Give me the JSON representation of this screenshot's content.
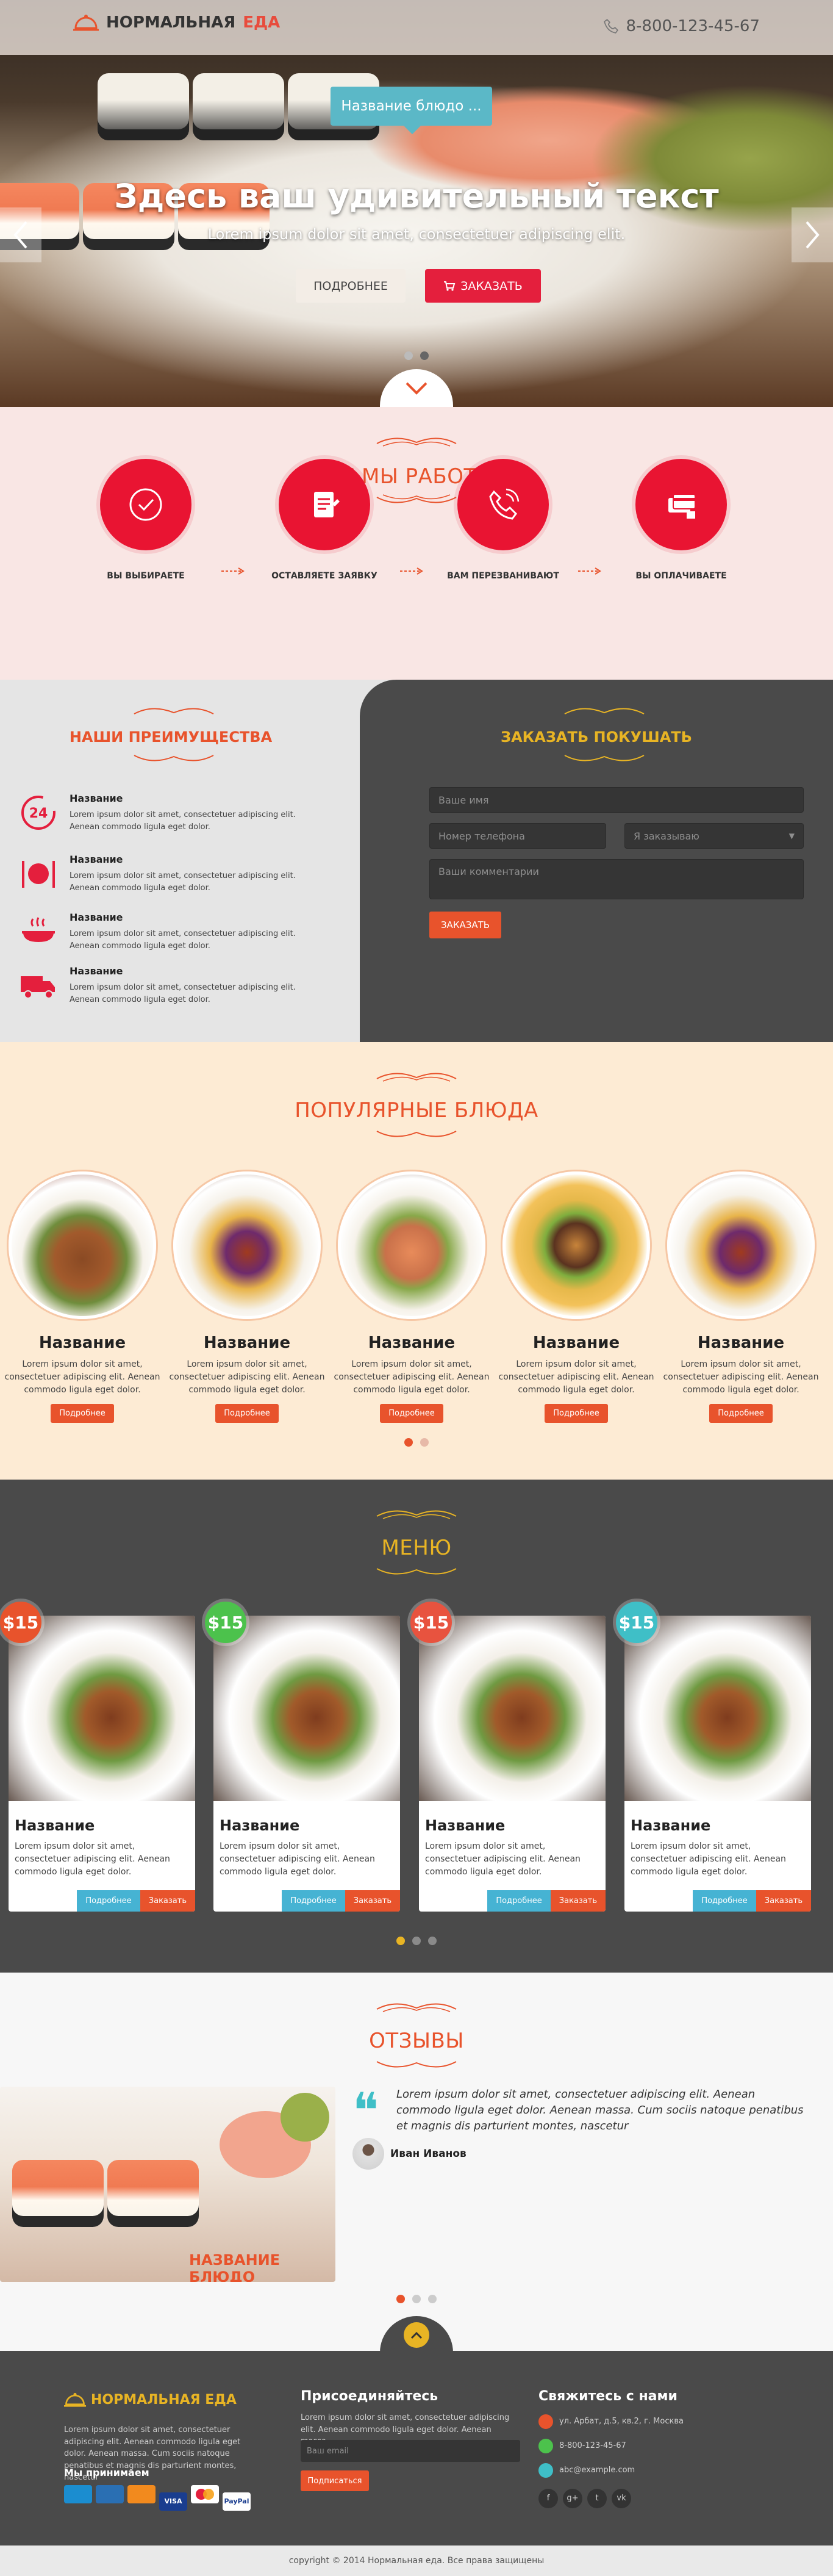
{
  "header": {
    "logo_part1": "НОРМАЛЬНАЯ",
    "logo_part2": "ЕДА",
    "phone": "8-800-123-45-67"
  },
  "hero": {
    "flag_label": "Название блюдо ...",
    "title": "Здесь ваш удивительный текст",
    "subtitle": "Lorem ipsum dolor sit amet, consectetuer adipiscing elit.",
    "btn_more": "ПОДРОБНЕЕ",
    "btn_order": "ЗАКАЗАТЬ"
  },
  "how": {
    "title": "КАК МЫ РАБОТАЕМ",
    "steps": [
      {
        "label": "ВЫ ВЫБИРАЕТЕ",
        "icon": "check-icon"
      },
      {
        "label": "ОСТАВЛЯЕТЕ ЗАЯВКУ",
        "icon": "form-icon"
      },
      {
        "label": "ВАМ ПЕРЕЗВАНИВАЮТ",
        "icon": "phone-icon"
      },
      {
        "label": "ВЫ ОПЛАЧИВАЕТЕ",
        "icon": "payment-icon"
      }
    ]
  },
  "advantages": {
    "title": "НАШИ ПРЕИМУЩЕСТВА",
    "items": [
      {
        "title": "Название",
        "text": "Lorem ipsum dolor sit amet, consectetuer adipiscing elit. Aenean commodo ligula eget dolor.",
        "icon": "clock-24-icon"
      },
      {
        "title": "Название",
        "text": "Lorem ipsum dolor sit amet, consectetuer adipiscing elit. Aenean commodo ligula eget dolor.",
        "icon": "cutlery-icon"
      },
      {
        "title": "Название",
        "text": "Lorem ipsum dolor sit amet, consectetuer adipiscing elit. Aenean commodo ligula eget dolor.",
        "icon": "hot-dish-icon"
      },
      {
        "title": "Название",
        "text": "Lorem ipsum dolor sit amet, consectetuer adipiscing elit. Aenean commodo ligula eget dolor.",
        "icon": "delivery-truck-icon"
      }
    ]
  },
  "order_form": {
    "title": "ЗАКАЗАТЬ ПОКУШАТЬ",
    "name_placeholder": "Ваше имя",
    "phone_placeholder": "Номер телефона",
    "select_value": "Я заказываю",
    "comment_placeholder": "Ваши комментарии",
    "submit": "ЗАКАЗАТЬ"
  },
  "popular": {
    "title": "ПОПУЛЯРНЫЕ БЛЮДА",
    "items": [
      {
        "name": "Название",
        "text": "Lorem ipsum dolor sit amet, consectetuer adipiscing elit. Aenean commodo ligula eget dolor.",
        "btn": "Подробнее"
      },
      {
        "name": "Название",
        "text": "Lorem ipsum dolor sit amet, consectetuer adipiscing elit. Aenean commodo ligula eget dolor.",
        "btn": "Подробнее"
      },
      {
        "name": "Название",
        "text": "Lorem ipsum dolor sit amet, consectetuer adipiscing elit. Aenean commodo ligula eget dolor.",
        "btn": "Подробнее"
      },
      {
        "name": "Название",
        "text": "Lorem ipsum dolor sit amet, consectetuer adipiscing elit. Aenean commodo ligula eget dolor.",
        "btn": "Подробнее"
      },
      {
        "name": "Название",
        "text": "Lorem ipsum dolor sit amet, consectetuer adipiscing elit. Aenean commodo ligula eget dolor.",
        "btn": "Подробнее"
      }
    ]
  },
  "menu": {
    "title": "МЕНЮ",
    "cards": [
      {
        "price": "$15",
        "price_color": "#e8532c",
        "name": "Название",
        "text": "Lorem ipsum dolor sit amet, consectetuer adipiscing elit. Aenean commodo ligula eget dolor.",
        "btn_more": "Подробнее",
        "btn_order": "Заказать"
      },
      {
        "price": "$15",
        "price_color": "#4cc24c",
        "name": "Название",
        "text": "Lorem ipsum dolor sit amet, consectetuer adipiscing elit. Aenean commodo ligula eget dolor.",
        "btn_more": "Подробнее",
        "btn_order": "Заказать"
      },
      {
        "price": "$15",
        "price_color": "#e8533f",
        "name": "Название",
        "text": "Lorem ipsum dolor sit amet, consectetuer adipiscing elit. Aenean commodo ligula eget dolor.",
        "btn_more": "Подробнее",
        "btn_order": "Заказать"
      },
      {
        "price": "$15",
        "price_color": "#3fbfc7",
        "name": "Название",
        "text": "Lorem ipsum dolor sit amet, consectetuer adipiscing elit. Aenean commodo ligula eget dolor.",
        "btn_more": "Подробнее",
        "btn_order": "Заказать"
      }
    ]
  },
  "reviews": {
    "title": "ОТЗЫВЫ",
    "image_caption": "НАЗВАНИЕ БЛЮДО",
    "quote": "Lorem ipsum dolor sit amet, consectetuer adipiscing elit. Aenean commodo ligula eget dolor. Aenean massa. Cum sociis natoque penatibus et magnis dis parturient montes, nascetur",
    "author": "Иван Иванов"
  },
  "footer": {
    "logo": "НОРМАЛЬНАЯ ЕДА",
    "about": "Lorem ipsum dolor sit amet, consectetuer adipiscing elit. Aenean commodo ligula eget dolor. Aenean massa. Cum sociis natoque penatibus et magnis dis parturient montes, nascetur",
    "pay_title": "Мы принимаем",
    "join_title": "Присоединяйтесь",
    "join_text": "Lorem ipsum dolor sit amet, consectetuer adipiscing elit. Aenean commodo ligula eget dolor. Aenean massa.",
    "email_placeholder": "Ваш email",
    "subscribe": "Подписаться",
    "contact_title": "Свяжитесь с нами",
    "address": "ул. Арбат, д.5, кв.2, г. Москва",
    "phone": "8-800-123-45-67",
    "email": "abc@example.com",
    "copyright": "copyright © 2014 Нормальная еда. Все права защищены"
  },
  "colors": {
    "accent": "#e8532c",
    "brand_red": "#e41f3d",
    "gold": "#e8b424",
    "dark": "#4a4a4a"
  }
}
